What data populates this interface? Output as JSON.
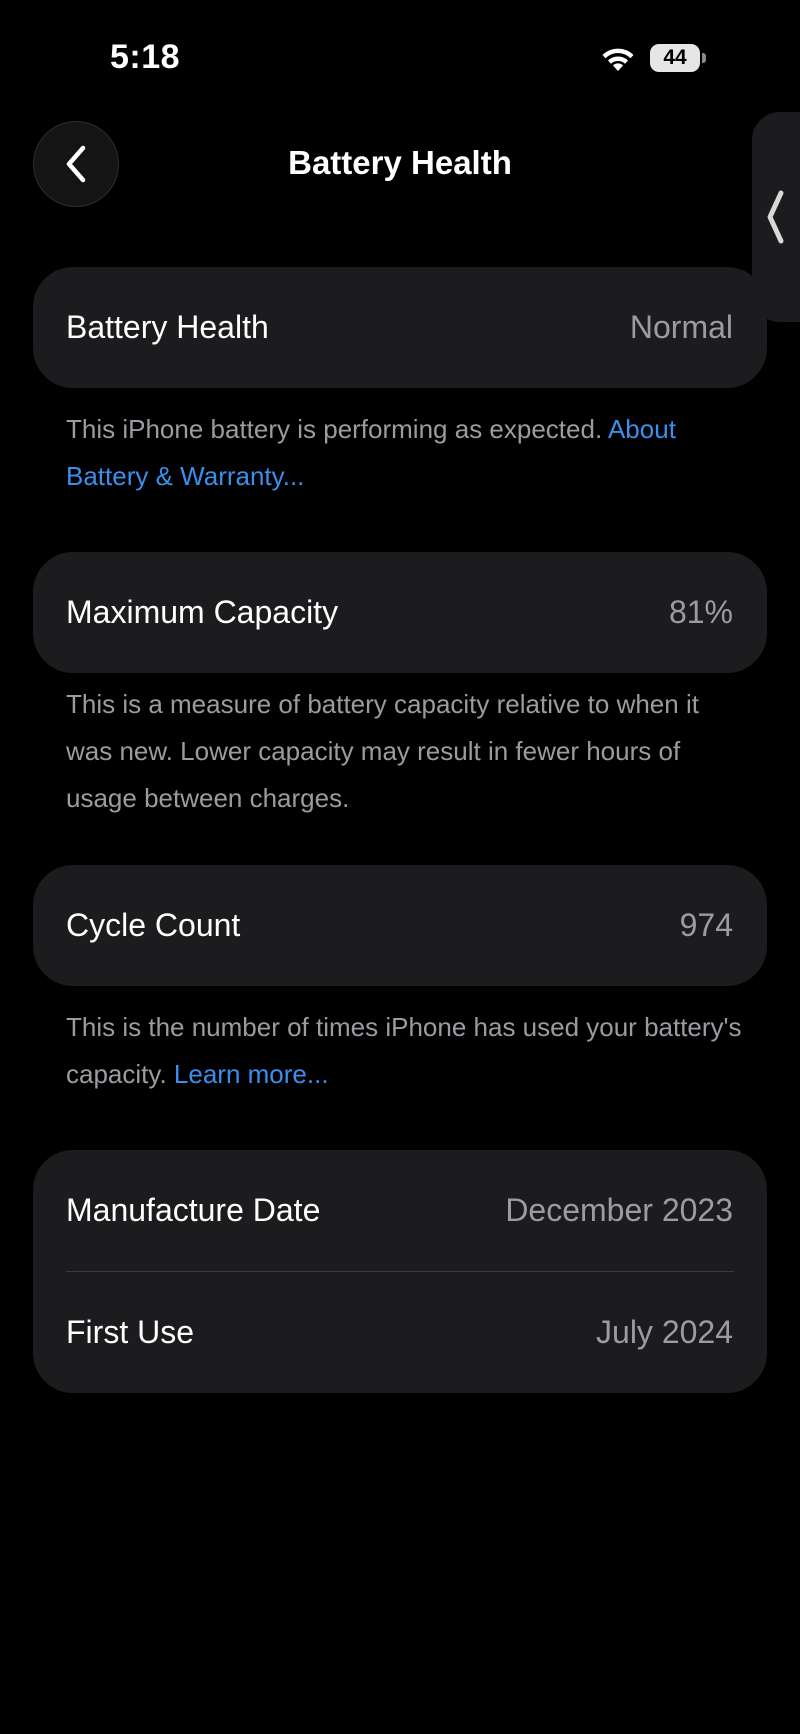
{
  "status_bar": {
    "time": "5:18",
    "battery_level": "44",
    "icons": [
      "wifi-icon",
      "battery-icon"
    ]
  },
  "nav": {
    "title": "Battery Health",
    "back_icon": "chevron-left-icon",
    "side_handle_icon": "chevron-left-icon"
  },
  "sections": {
    "health": {
      "label": "Battery Health",
      "value": "Normal",
      "footnote_text": "This iPhone battery is performing as expected.",
      "footnote_link": "About Battery & Warranty..."
    },
    "capacity": {
      "label": "Maximum Capacity",
      "value": "81%",
      "footnote_text": "This is a measure of battery capacity relative to when it was new. Lower capacity may result in fewer hours of usage between charges."
    },
    "cycles": {
      "label": "Cycle Count",
      "value": "974",
      "footnote_text": "This is the number of times iPhone has used your battery's capacity.",
      "footnote_link": "Learn more..."
    },
    "dates": {
      "manufacture_label": "Manufacture Date",
      "manufacture_value": "December 2023",
      "first_use_label": "First Use",
      "first_use_value": "July 2024"
    }
  },
  "colors": {
    "background": "#000000",
    "card": "#1c1c1e",
    "secondary_text": "#9b9ba1",
    "link": "#3b8eea"
  }
}
